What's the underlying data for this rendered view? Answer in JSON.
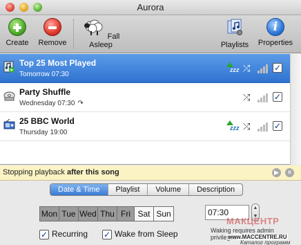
{
  "window": {
    "title": "Aurora"
  },
  "toolbar": {
    "create_label": "Create",
    "remove_label": "Remove",
    "fall_asleep_label": "Fall Asleep",
    "playlists_label": "Playlists",
    "properties_label": "Properties"
  },
  "alarms": [
    {
      "title": "Top 25 Most Played",
      "subtitle": "Tomorrow 07:30",
      "icon": "itunes-icon",
      "selected": true,
      "sleep_arrow": true,
      "shuffle": true,
      "signal": true,
      "enabled": true
    },
    {
      "title": "Party Shuffle",
      "subtitle": "Wednesday 07:30",
      "icon": "cd-icon",
      "selected": false,
      "repeat": true,
      "shuffle": true,
      "signal": true,
      "enabled": true
    },
    {
      "title": "25 BBC World",
      "subtitle": "Thursday 19:00",
      "icon": "radio-icon",
      "selected": false,
      "sleep_arrow": true,
      "shuffle": true,
      "signal": true,
      "enabled": true
    }
  ],
  "notice": {
    "prefix": "Stopping playback ",
    "bold": "after this song"
  },
  "tabs": [
    {
      "label": "Date & Time",
      "active": true
    },
    {
      "label": "Playlist",
      "active": false
    },
    {
      "label": "Volume",
      "active": false
    },
    {
      "label": "Description",
      "active": false
    }
  ],
  "days": [
    {
      "label": "Mon",
      "on": true
    },
    {
      "label": "Tue",
      "on": true
    },
    {
      "label": "Wed",
      "on": true
    },
    {
      "label": "Thu",
      "on": true
    },
    {
      "label": "Fri",
      "on": true
    },
    {
      "label": "Sat",
      "on": false
    },
    {
      "label": "Sun",
      "on": false
    }
  ],
  "time_value": "07:30",
  "options": {
    "recurring_label": "Recurring",
    "recurring_checked": true,
    "wake_label": "Wake from Sleep",
    "wake_checked": true
  },
  "waking_note": "Waking requires admin privileges",
  "watermark": {
    "title": "МАКЦЕНТР",
    "url": "www.MACCENTRE.RU",
    "sub": "Каталог программ"
  },
  "colors": {
    "selection": "#3a7dd6",
    "notice_bg": "#fbf3c4",
    "active_tab": "#3b7bd3"
  }
}
